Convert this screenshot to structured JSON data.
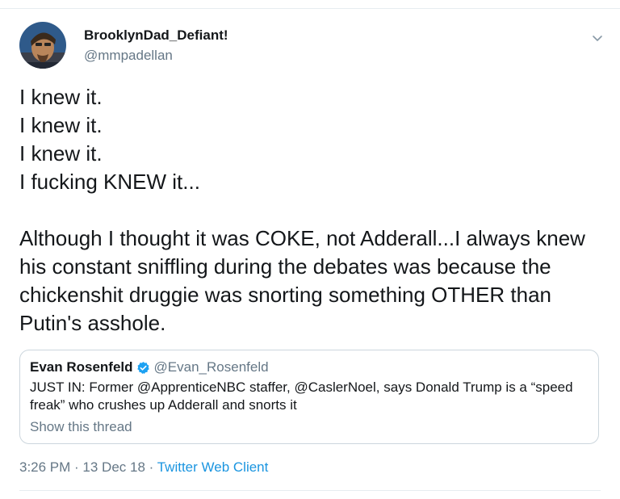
{
  "tweet": {
    "author": {
      "display_name": "BrooklynDad_Defiant!",
      "handle": "@mmpadellan"
    },
    "text": "I knew it.\nI knew it.\nI knew it.\nI fucking KNEW it...\n\nAlthough I thought it was COKE, not Adderall...I always knew his constant sniffling during the debates was because the chickenshit druggie was snorting something OTHER than Putin's asshole.",
    "quoted": {
      "name": "Evan Rosenfeld",
      "handle": "@Evan_Rosenfeld",
      "text": "JUST IN: Former @ApprenticeNBC staffer, @CaslerNoel, says Donald Trump is a “speed freak” who crushes up Adderall and snorts it",
      "show_thread": "Show this thread"
    },
    "meta": {
      "time": "3:26 PM",
      "separator1": " · ",
      "date": "13 Dec 18",
      "separator2": " · ",
      "client": "Twitter Web Client"
    }
  },
  "colors": {
    "text": "#14171a",
    "secondary": "#657786",
    "link": "#1b95e0",
    "border": "#ccd6dd"
  },
  "icons": {
    "avatar": "profile-photo",
    "caret": "chevron-down-icon",
    "verified": "verified-badge-icon"
  }
}
